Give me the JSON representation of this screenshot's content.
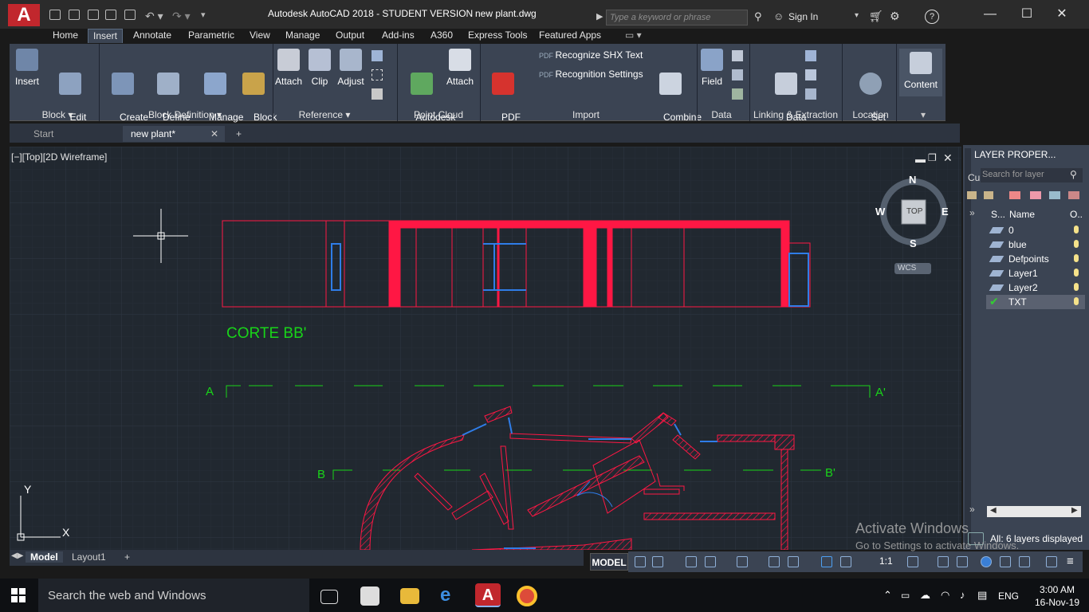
{
  "titlebar": {
    "app": "Autodesk AutoCAD 2018 - STUDENT VERSION",
    "file": "new plant.dwg",
    "search_placeholder": "Type a keyword or phrase",
    "sign_in": "Sign In"
  },
  "ribbon_tabs": [
    "Home",
    "Insert",
    "Annotate",
    "Parametric",
    "View",
    "Manage",
    "Output",
    "Add-ins",
    "A360",
    "Express Tools",
    "Featured Apps"
  ],
  "active_tab": "Insert",
  "ribbon": {
    "buttons": {
      "insert": "Insert",
      "edit_attribute": "Edit\nAttribute",
      "create_block": "Create\nBlock",
      "define_attributes": "Define\nAttributes",
      "manage_attributes": "Manage\nAttributes",
      "block_editor": "Block\nEditor",
      "attach": "Attach",
      "clip": "Clip",
      "adjust": "Adjust",
      "autodesk_recap": "Autodesk\nReCap",
      "attach_pc": "Attach",
      "pdf_import": "PDF\nImport",
      "recognize_shx": "Recognize SHX Text",
      "recognition_settings": "Recognition Settings",
      "combine_text": "Combine\nText",
      "field": "Field",
      "data_link": "Data\nLink",
      "set_location": "Set\nLocation",
      "content": "Content"
    },
    "panels": {
      "block": "Block",
      "block_definition": "Block Definition",
      "reference": "Reference",
      "point_cloud": "Point Cloud",
      "import": "Import",
      "data": "Data",
      "linking": "Linking & Extraction",
      "location": "Location"
    }
  },
  "file_tabs": {
    "start": "Start",
    "current": "new plant*"
  },
  "viewport": {
    "label": "[−][Top][2D Wireframe]",
    "compass": {
      "n": "N",
      "s": "S",
      "e": "E",
      "w": "W",
      "center": "TOP",
      "wcs": "WCS"
    }
  },
  "drawing_text": {
    "corte": "CORTE BB'",
    "a": "A",
    "a_prime": "A'",
    "b": "B",
    "b_prime": "B'"
  },
  "layer_palette": {
    "title": "LAYER PROPER...",
    "current_prefix": "Cu",
    "search_placeholder": "Search for layer",
    "col_s": "S...",
    "col_name": "Name",
    "col_o": "O..",
    "layers": [
      "0",
      "blue",
      "Defpoints",
      "Layer1",
      "Layer2",
      "TXT"
    ],
    "selected": "TXT",
    "status": "All: 6 layers displayed"
  },
  "model_tabs": {
    "model": "Model",
    "layout1": "Layout1",
    "add": "+"
  },
  "statusbar": {
    "model": "MODEL",
    "scale": "1:1"
  },
  "watermark": {
    "line1": "Activate Windows",
    "line2": "Go to Settings to activate Windows."
  },
  "taskbar": {
    "search": "Search the web and Windows",
    "lang": "ENG",
    "time": "3:00 AM",
    "date": "16-Nov-19"
  },
  "colors": {
    "red": "#ff1744",
    "green": "#19d419",
    "blue": "#2f7de8",
    "bg": "#212830",
    "grid": "#2a323c"
  }
}
